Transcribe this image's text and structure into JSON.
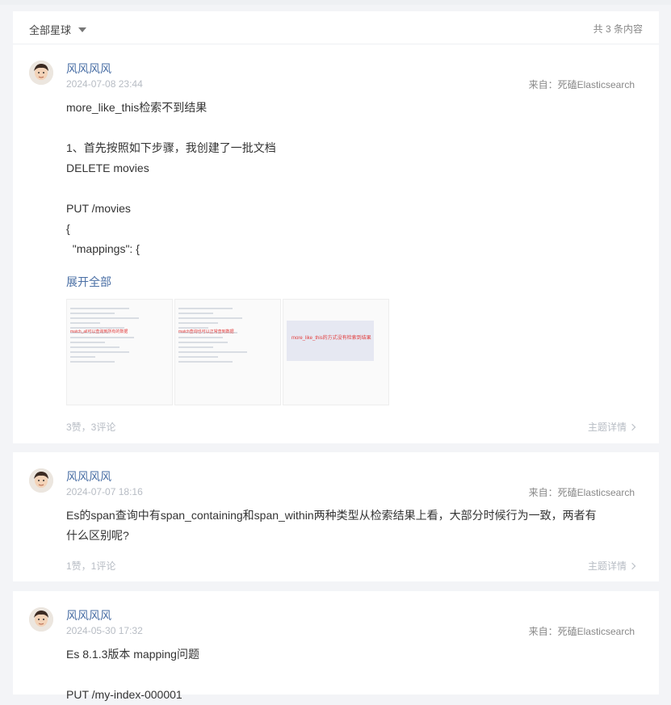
{
  "filter": {
    "label": "全部星球",
    "count": "共 3 条内容"
  },
  "posts": [
    {
      "author": "风风风风",
      "date": "2024-07-08 23:44",
      "source": "来自：死磕Elasticsearch",
      "lines": [
        "more_like_this检索不到结果",
        "",
        "1、首先按照如下步骤，我创建了一批文档",
        "DELETE movies",
        "",
        "PUT /movies",
        "{",
        "  \"mappings\": {"
      ],
      "expand": "展开全部",
      "images": [
        {
          "caption": "match_all可以查询到所有的数据"
        },
        {
          "caption": "match查询也可以正常查到数据"
        },
        {
          "caption": "more_like_this的方式没有检索到结果"
        }
      ],
      "stats": "3赞，3评论",
      "detail": "主题详情"
    },
    {
      "author": "风风风风",
      "date": "2024-07-07 18:16",
      "source": "来自：死磕Elasticsearch",
      "lines": [
        "Es的span查询中有span_containing和span_within两种类型从检索结果上看，大部分时候行为一致，两者有",
        "什么区别呢?"
      ],
      "stats": "1赞，1评论",
      "detail": "主题详情"
    },
    {
      "author": "风风风风",
      "date": "2024-05-30 17:32",
      "source": "来自：死磕Elasticsearch",
      "lines": [
        "Es 8.1.3版本 mapping问题",
        "",
        "PUT /my-index-000001"
      ]
    }
  ]
}
